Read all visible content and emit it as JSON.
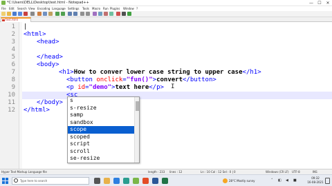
{
  "window": {
    "title": "*C:\\Users\\DELL\\Desktop\\test.html - Notepad++",
    "minimize_glyph": "—",
    "maximize_glyph": "☐",
    "close_glyph": "✕"
  },
  "menu": [
    "File",
    "Edit",
    "Search",
    "View",
    "Encoding",
    "Language",
    "Settings",
    "Tools",
    "Macro",
    "Run",
    "Plugins",
    "Window",
    "?"
  ],
  "tab": {
    "label": "test.html"
  },
  "editor": {
    "line_numbers": [
      "1",
      "2",
      "3",
      "4",
      "5",
      "6",
      "7",
      "8",
      "9",
      "10",
      "11",
      "12"
    ],
    "line1": {
      "text": "|"
    },
    "line2": {
      "open": "<html>"
    },
    "line3": {
      "open": "<head>"
    },
    "line5": {
      "close": "</head>"
    },
    "line6": {
      "open": "<body>"
    },
    "line7": {
      "open": "<h1>",
      "text": "How to conver lower case string to upper case",
      "close": "</h1>"
    },
    "line8": {
      "open": "<button",
      "attr": "onclick",
      "eq": "=",
      "value": "\"fun()\"",
      "gt": ">",
      "text": "convert",
      "close": "</button>"
    },
    "line9": {
      "open": "<p",
      "attr": "id",
      "eq": "=",
      "value": "\"demo\"",
      "gt": ">",
      "text": "text here",
      "close": "</p>"
    },
    "line10": {
      "typed": "<sc"
    },
    "line11": {
      "close": "</body>"
    },
    "line12": {
      "close": "</html>"
    }
  },
  "autocomplete": {
    "items": [
      "s",
      "s-resize",
      "samp",
      "sandbox",
      "scope",
      "scoped",
      "script",
      "scroll",
      "se-resize"
    ],
    "selected": "scope"
  },
  "statusbar": {
    "file_type": "Hyper Text Markup Language file",
    "length": "length : 233",
    "lines": "lines : 12",
    "position": "Ln : 10   Col : 12   Sel : 0 | 0",
    "eol": "Windows (CR LF)",
    "encoding": "UTF-8",
    "mode": "INS"
  },
  "taskbar": {
    "search_placeholder": "Type here to search",
    "weather": "28°C  Mostly sunny",
    "time": "09:32",
    "date": "16-08-2021"
  },
  "colors": {
    "tag": "#0000ff",
    "attribute": "#ff0000",
    "attr_value": "#8000ff",
    "selection": "#0a5fd0",
    "tab_accent": "#f59c2c"
  }
}
